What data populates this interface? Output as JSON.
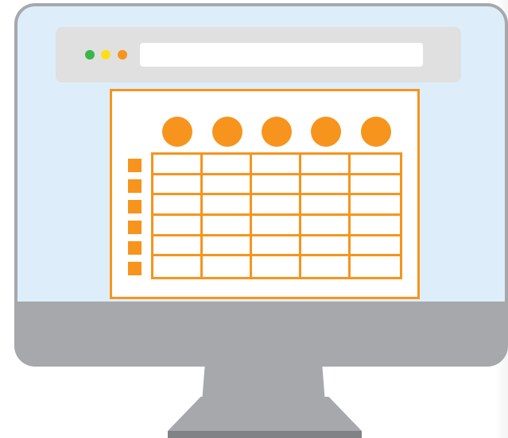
{
  "illustration": {
    "subject": "desktop-monitor-with-spreadsheet",
    "colors": {
      "monitor_frame": "#a6a8ab",
      "screen": "#ddeefa",
      "browser_bar": "#e0e0e1",
      "accent": "#f7941d",
      "dot_green": "#3cb54a",
      "dot_yellow": "#ffde17",
      "dot_orange": "#f7941d"
    },
    "window_dots": [
      "green",
      "yellow",
      "orange"
    ],
    "header_circles": 5,
    "table": {
      "columns": 5,
      "rows": 6,
      "row_markers": 6
    }
  }
}
